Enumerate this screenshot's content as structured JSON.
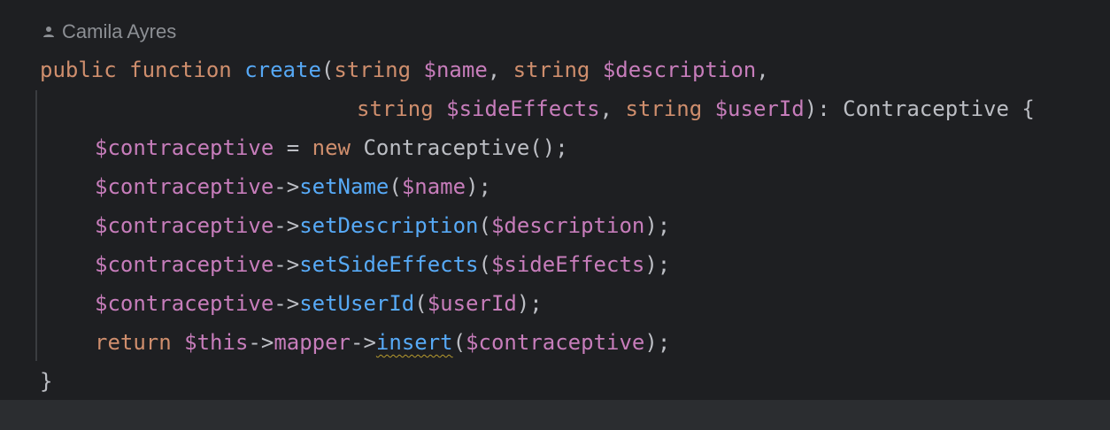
{
  "author": {
    "icon": "person-icon",
    "name": "Camila Ayres"
  },
  "code": {
    "line1": {
      "kw_public": "public",
      "kw_function": "function",
      "fn_name": "create",
      "paren_open": "(",
      "type1": "string",
      "param1": "$name",
      "comma1": ", ",
      "type2": "string",
      "param2": "$description",
      "comma2": ","
    },
    "line2": {
      "type3": "string",
      "param3": "$sideEffects",
      "comma3": ", ",
      "type4": "string",
      "param4": "$userId",
      "return_sig": "): Contraceptive {"
    },
    "line3": {
      "var": "$contraceptive",
      "assign": " = ",
      "kw_new": "new",
      "class_call": " Contraceptive();"
    },
    "line4": {
      "var": "$contraceptive",
      "arrow": "->",
      "method": "setName",
      "open": "(",
      "arg": "$name",
      "close": ");"
    },
    "line5": {
      "var": "$contraceptive",
      "arrow": "->",
      "method": "setDescription",
      "open": "(",
      "arg": "$description",
      "close": ");"
    },
    "line6": {
      "var": "$contraceptive",
      "arrow": "->",
      "method": "setSideEffects",
      "open": "(",
      "arg": "$sideEffects",
      "close": ");"
    },
    "line7": {
      "var": "$contraceptive",
      "arrow": "->",
      "method": "setUserId",
      "open": "(",
      "arg": "$userId",
      "close": ");"
    },
    "line8": {
      "kw_return": "return",
      "this": "$this",
      "arrow1": "->",
      "prop": "mapper",
      "arrow2": "->",
      "method": "insert",
      "open": "(",
      "arg": "$contraceptive",
      "close": ");"
    },
    "line9": {
      "brace": "}"
    }
  },
  "colors": {
    "background": "#1e1f22",
    "keyword": "#cf8e6d",
    "function": "#56a8f5",
    "variable": "#c77dbb",
    "text": "#bcbec4"
  }
}
